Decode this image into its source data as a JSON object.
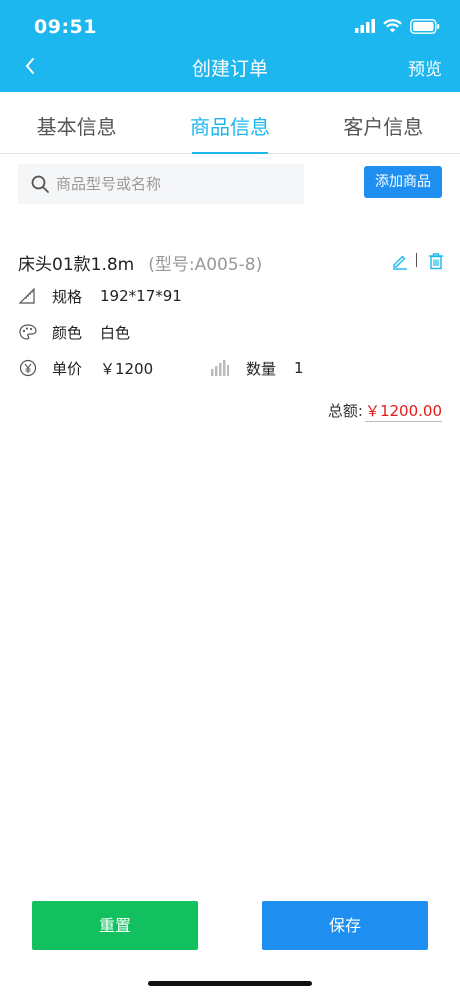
{
  "status_bar": {
    "time": "09:51"
  },
  "nav": {
    "title": "创建订单",
    "preview_label": "预览"
  },
  "tabs": [
    {
      "label": "基本信息",
      "active": false
    },
    {
      "label": "商品信息",
      "active": true
    },
    {
      "label": "客户信息",
      "active": false
    }
  ],
  "search": {
    "placeholder": "商品型号或名称",
    "value": ""
  },
  "add_button_label": "添加商品",
  "product": {
    "name": "床头01款1.8m",
    "model": "(型号:A005-8)",
    "spec_label": "规格",
    "spec_value": "192*17*91",
    "color_label": "颜色",
    "color_value": "白色",
    "price_label": "单价",
    "price_value": "￥1200",
    "qty_label": "数量",
    "qty_value": "1"
  },
  "total": {
    "label": "总额:",
    "amount": "￥1200.00"
  },
  "footer": {
    "reset_label": "重置",
    "save_label": "保存"
  },
  "colors": {
    "accent": "#1cb7ee",
    "button_blue": "#1e8ef0",
    "button_green": "#12c05f",
    "price_red": "#e21c1c"
  },
  "icons": [
    "back-icon",
    "search-icon",
    "edit-icon",
    "delete-icon",
    "ruler-icon",
    "palette-icon",
    "yen-icon",
    "bar-chart-icon",
    "signal-icon",
    "wifi-icon",
    "battery-icon"
  ]
}
